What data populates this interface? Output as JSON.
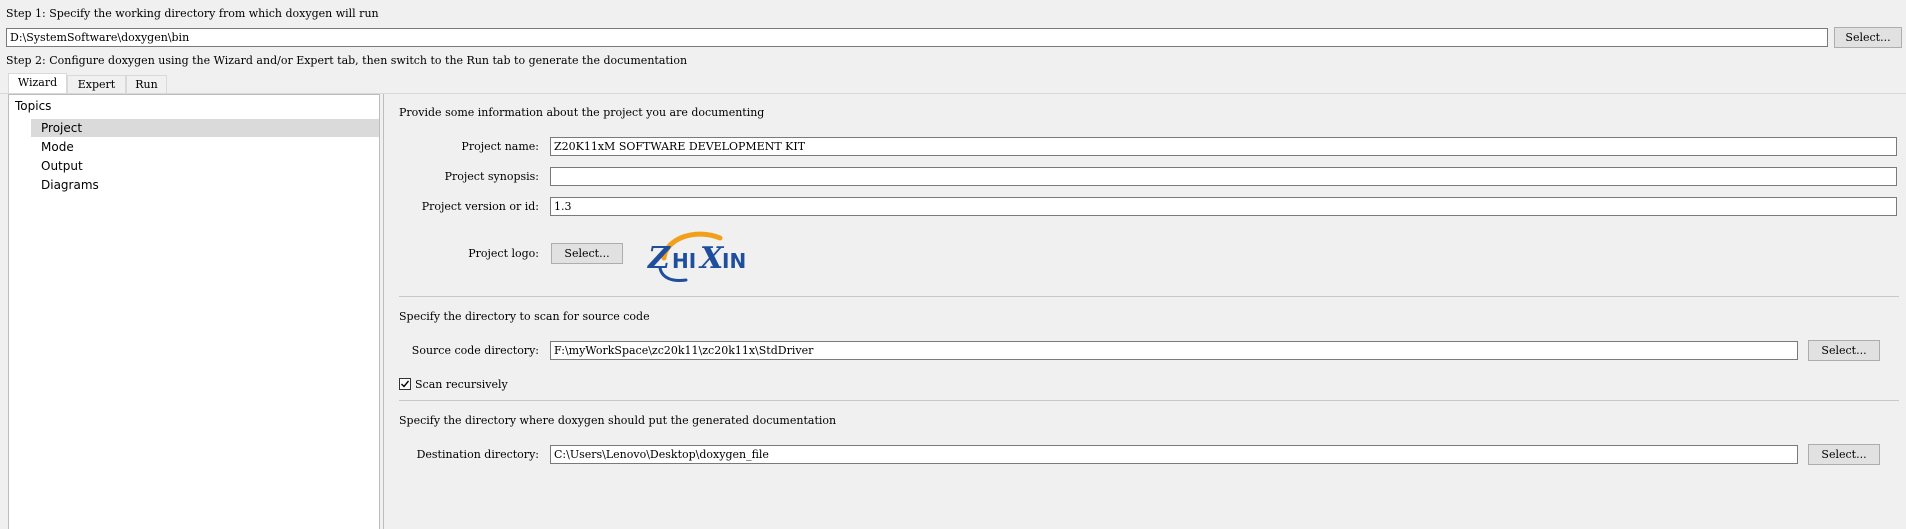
{
  "step1": {
    "label": "Step 1: Specify the working directory from which doxygen will run",
    "directory_value": "D:\\SystemSoftware\\doxygen\\bin",
    "select_label": "Select..."
  },
  "step2": {
    "label": "Step 2: Configure doxygen using the Wizard and/or Expert tab, then switch to the Run tab to generate the documentation"
  },
  "tabs": [
    {
      "label": "Wizard",
      "active": true
    },
    {
      "label": "Expert",
      "active": false
    },
    {
      "label": "Run",
      "active": false
    }
  ],
  "topics": {
    "title": "Topics",
    "items": [
      {
        "label": "Project",
        "selected": true
      },
      {
        "label": "Mode",
        "selected": false
      },
      {
        "label": "Output",
        "selected": false
      },
      {
        "label": "Diagrams",
        "selected": false
      }
    ]
  },
  "project": {
    "intro": "Provide some information about the project you are documenting",
    "name_label": "Project name:",
    "name_value": "Z20K11xM SOFTWARE DEVELOPMENT KIT",
    "synopsis_label": "Project synopsis:",
    "synopsis_value": "",
    "version_label": "Project version or id:",
    "version_value": "1.3",
    "logo_label": "Project logo:",
    "logo_select_label": "Select...",
    "logo_text": "ZHIXIN"
  },
  "source": {
    "intro": "Specify the directory to scan for source code",
    "dir_label": "Source code directory:",
    "dir_value": "F:\\myWorkSpace\\zc20k11\\zc20k11x\\StdDriver",
    "select_label": "Select...",
    "scan_recursively_label": "Scan recursively",
    "scan_recursively_checked": true
  },
  "destination": {
    "intro": "Specify the directory where doxygen should put the generated documentation",
    "dir_label": "Destination directory:",
    "dir_value": "C:\\Users\\Lenovo\\Desktop\\doxygen_file",
    "select_label": "Select..."
  },
  "colors": {
    "logo_blue": "#1f4e9c",
    "logo_orange": "#f2a01a",
    "selection": "#dadada"
  }
}
